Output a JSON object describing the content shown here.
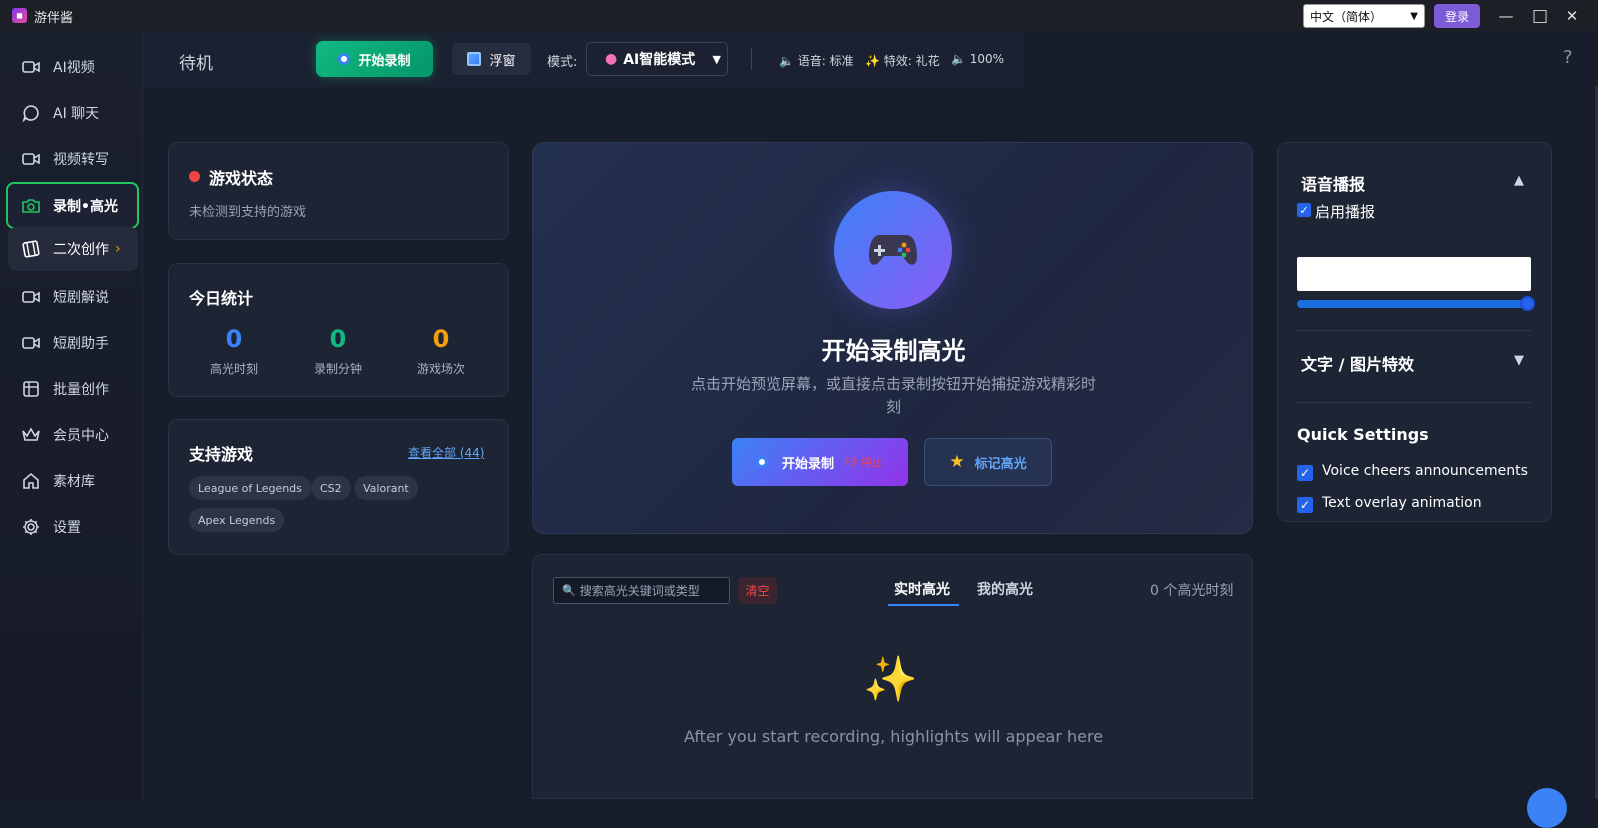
{
  "titlebar": {
    "app_title": "游伴酱",
    "language": "中文（简体）",
    "login": "登录",
    "minimize": "—",
    "maximize": "□",
    "close": "✕"
  },
  "sidebar": {
    "items": [
      {
        "label": "AI视频",
        "icon": "video-camera-icon"
      },
      {
        "label": "AI 聊天",
        "icon": "chat-bubble-icon"
      },
      {
        "label": "视频转写",
        "icon": "video-camera-icon"
      },
      {
        "label": "录制•高光",
        "icon": "camera-icon"
      },
      {
        "label": "二次创作",
        "icon": "film-icon"
      },
      {
        "label": "短剧解说",
        "icon": "video-camera-icon"
      },
      {
        "label": "短剧助手",
        "icon": "video-camera-icon"
      },
      {
        "label": "批量创作",
        "icon": "grid-icon"
      },
      {
        "label": "会员中心",
        "icon": "crown-icon"
      },
      {
        "label": "素材库",
        "icon": "home-icon"
      },
      {
        "label": "设置",
        "icon": "gear-icon"
      }
    ],
    "sub_arrow": "›"
  },
  "toolbar": {
    "status": "待机",
    "start_record": "开始录制",
    "float_window": "浮窗",
    "mode_label": "模式:",
    "mode_value": "AI智能模式",
    "voice": "🔈 语音: 标准",
    "effect": "✨ 特效: 礼花",
    "volume": "🔈 100%",
    "help": "?"
  },
  "game_status": {
    "title": "游戏状态",
    "desc": "未检测到支持的游戏"
  },
  "today_stats": {
    "title": "今日统计",
    "items": [
      {
        "value": "0",
        "label": "高光时刻",
        "color": "#3b82f6"
      },
      {
        "value": "0",
        "label": "录制分钟",
        "color": "#10b981"
      },
      {
        "value": "0",
        "label": "游戏场次",
        "color": "#f59e0b"
      }
    ]
  },
  "supported_games": {
    "title": "支持游戏",
    "view_all": "查看全部 (44)",
    "games": [
      "League of Legends",
      "CS2",
      "Valorant",
      "Apex Legends"
    ]
  },
  "hero": {
    "title": "开始录制高光",
    "desc": "点击开始预览屏幕，或直接点击录制按钮开始捕捉游戏精彩时刻",
    "record_btn": "开始录制",
    "record_hint": "F9 停止",
    "mark_btn": "标记高光"
  },
  "highlights": {
    "search_placeholder": "搜索高光关键词或类型",
    "clear": "清空",
    "tabs": [
      "实时高光",
      "我的高光"
    ],
    "count": "0 个高光时刻",
    "empty": "After you start recording, highlights will appear here"
  },
  "right": {
    "voice_title": "语音播报",
    "voice_enable": "启用播报",
    "effects_title": "文字 / 图片特效",
    "quick_title": "Quick Settings",
    "quick_options": [
      "Voice cheers announcements",
      "Text overlay animation"
    ],
    "expand_up": "▲",
    "expand_down": "▼"
  },
  "colors": {
    "accent_green": "#10b981",
    "accent_blue": "#3b82f6",
    "accent_purple": "#8b5cf6",
    "danger": "#ef4444"
  }
}
